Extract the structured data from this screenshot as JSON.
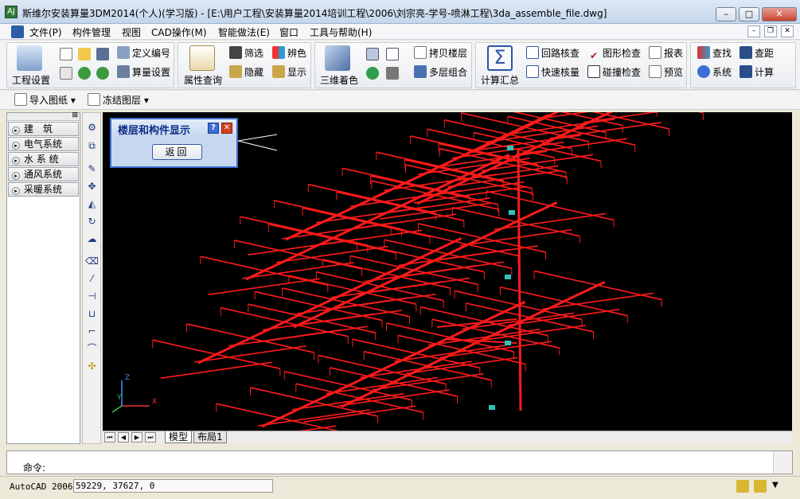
{
  "window": {
    "app_icon": "AJ",
    "title": "斯维尔安装算量3DM2014(个人)(学习版) - [E:\\用户工程\\安装算量2014培训工程\\2006\\刘宗亮-学号-喷淋工程\\3da_assemble_file.dwg]",
    "min_glyph": "–",
    "max_glyph": "□",
    "close_glyph": "✕"
  },
  "menu": {
    "items": [
      "文件(P)",
      "构件管理",
      "视图",
      "CAD操作(M)",
      "智能做法(E)",
      "窗口",
      "工具与帮助(H)"
    ],
    "mdi_min": "–",
    "mdi_restore": "❐",
    "mdi_close": "✕"
  },
  "ribbon": {
    "project_settings": "工程设置",
    "define_number": "定义编号",
    "calc_settings": "算量设置",
    "attr_query": "属性查询",
    "filter": "筛选",
    "hide": "隐藏",
    "distinguish_color": "辨色",
    "display": "显示",
    "three_d_color": "三维着色",
    "copy_floor": "拷贝楼层",
    "multi_floor": "多层组合",
    "calc_summary": "计算汇总",
    "loop_check": "回路核查",
    "quick_check": "快速核量",
    "graph_check": "图形检查",
    "collision_check": "碰撞检查",
    "report": "报表",
    "preview": "预览",
    "find": "查找",
    "check_distance": "查距",
    "system": "系统",
    "calculate": "计算"
  },
  "toolbar2": {
    "import_drawing": "导入图纸",
    "freeze_layer": "冻结图层"
  },
  "left_panel": {
    "items": [
      "建　筑",
      "电气系统",
      "水 系 统",
      "通风系统",
      "采暖系统"
    ]
  },
  "dialog": {
    "title": "楼层和构件显示",
    "help": "?",
    "close": "✕",
    "back_button": "返回"
  },
  "tabs": {
    "model": "模型",
    "layout1": "布局1"
  },
  "axes": {
    "x": "X",
    "y": "Y",
    "z": "Z"
  },
  "command": {
    "prompt": "命令:"
  },
  "status": {
    "app": "AutoCAD 2006",
    "coords": "59229, 37627, 0"
  },
  "colors": {
    "pipe": "#ff1a1a",
    "canvas_bg": "#000000",
    "dialog_border": "#3a6fd1"
  }
}
